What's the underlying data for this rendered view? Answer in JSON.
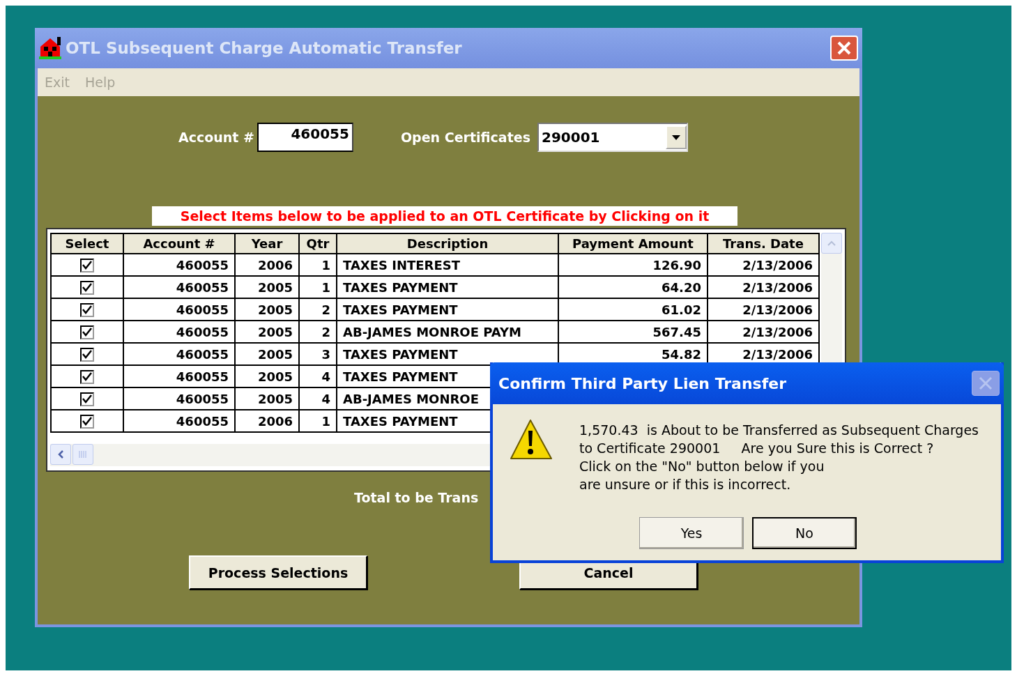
{
  "window": {
    "title": "OTL Subsequent Charge Automatic Transfer"
  },
  "menu": [
    {
      "label": "Exit",
      "disabled": true
    },
    {
      "label": "Help",
      "disabled": true
    }
  ],
  "account": {
    "label": "Account #",
    "value": "460055"
  },
  "certificates": {
    "label": "Open Certificates",
    "value": "290001"
  },
  "instruction": "Select Items below to be applied to an OTL Certificate by Clicking on it",
  "table": {
    "columns": [
      "Select",
      "Account #",
      "Year",
      "Qtr",
      "Description",
      "Payment Amount",
      "Trans. Date"
    ],
    "rows": [
      {
        "checked": true,
        "account": "460055",
        "year": "2006",
        "qtr": "1",
        "description": "TAXES INTEREST",
        "amount": "126.90",
        "date": "2/13/2006"
      },
      {
        "checked": true,
        "account": "460055",
        "year": "2005",
        "qtr": "1",
        "description": "TAXES PAYMENT",
        "amount": "64.20",
        "date": "2/13/2006"
      },
      {
        "checked": true,
        "account": "460055",
        "year": "2005",
        "qtr": "2",
        "description": "TAXES PAYMENT",
        "amount": "61.02",
        "date": "2/13/2006"
      },
      {
        "checked": true,
        "account": "460055",
        "year": "2005",
        "qtr": "2",
        "description": "AB-JAMES MONROE PAYM",
        "amount": "567.45",
        "date": "2/13/2006"
      },
      {
        "checked": true,
        "account": "460055",
        "year": "2005",
        "qtr": "3",
        "description": "TAXES PAYMENT",
        "amount": "54.82",
        "date": "2/13/2006"
      },
      {
        "checked": true,
        "account": "460055",
        "year": "2005",
        "qtr": "4",
        "description": "TAXES PAYMENT"
      },
      {
        "checked": true,
        "account": "460055",
        "year": "2005",
        "qtr": "4",
        "description": "AB-JAMES MONROE"
      },
      {
        "checked": true,
        "account": "460055",
        "year": "2006",
        "qtr": "1",
        "description": "TAXES PAYMENT"
      }
    ]
  },
  "total_label": "Total to be Trans",
  "buttons": [
    "Process Selections",
    "Cancel"
  ],
  "dialog": {
    "title": "Confirm Third Party Lien Transfer",
    "close_disabled": true,
    "lines": [
      "1,570.43  is About to be Transferred as Subsequent Charges",
      "to Certificate 290001     Are you Sure this is Correct ?",
      "Click on the \"No\" button below if you",
      "are unsure or if this is incorrect."
    ],
    "buttons": [
      {
        "label": "Yes",
        "default": false
      },
      {
        "label": "No",
        "default": true
      }
    ]
  }
}
